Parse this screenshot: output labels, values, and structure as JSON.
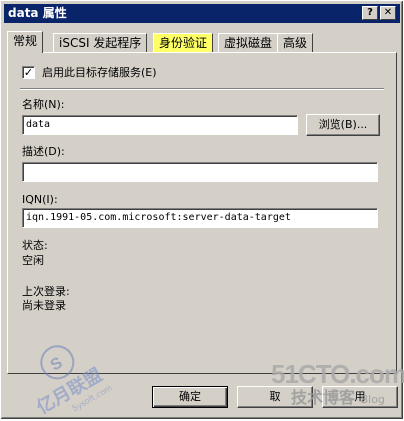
{
  "window": {
    "title": "data 属性"
  },
  "tabs": [
    {
      "label": "常规"
    },
    {
      "label": "iSCSI 发起程序"
    },
    {
      "label": "身份验证"
    },
    {
      "label": "虚拟磁盘"
    },
    {
      "label": "高级"
    }
  ],
  "general": {
    "enable_label": "启用此目标存储服务(E)",
    "enable_checked": "✓",
    "name_label": "名称(N):",
    "name_value": "data",
    "browse_label": "浏览(B)...",
    "desc_label": "描述(D):",
    "desc_value": "",
    "iqn_label": "IQN(I):",
    "iqn_value": "iqn.1991-05.com.microsoft:server-data-target",
    "status_label": "状态:",
    "status_value": "空闲",
    "last_login_label": "上次登录:",
    "last_login_value": "尚未登录"
  },
  "buttons": {
    "ok": "确定",
    "cancel": "取",
    "apply": "用"
  },
  "watermark": {
    "left_text": "亿月联盟",
    "left_sub": "5ysoft.com",
    "right_main": "51CTO.com",
    "right_sub": "技术博客",
    "right_blog": "Blog"
  },
  "colors": {
    "titlebar": "#0a246a",
    "face": "#d4d0c8",
    "highlight_tab": "#ffff66"
  }
}
